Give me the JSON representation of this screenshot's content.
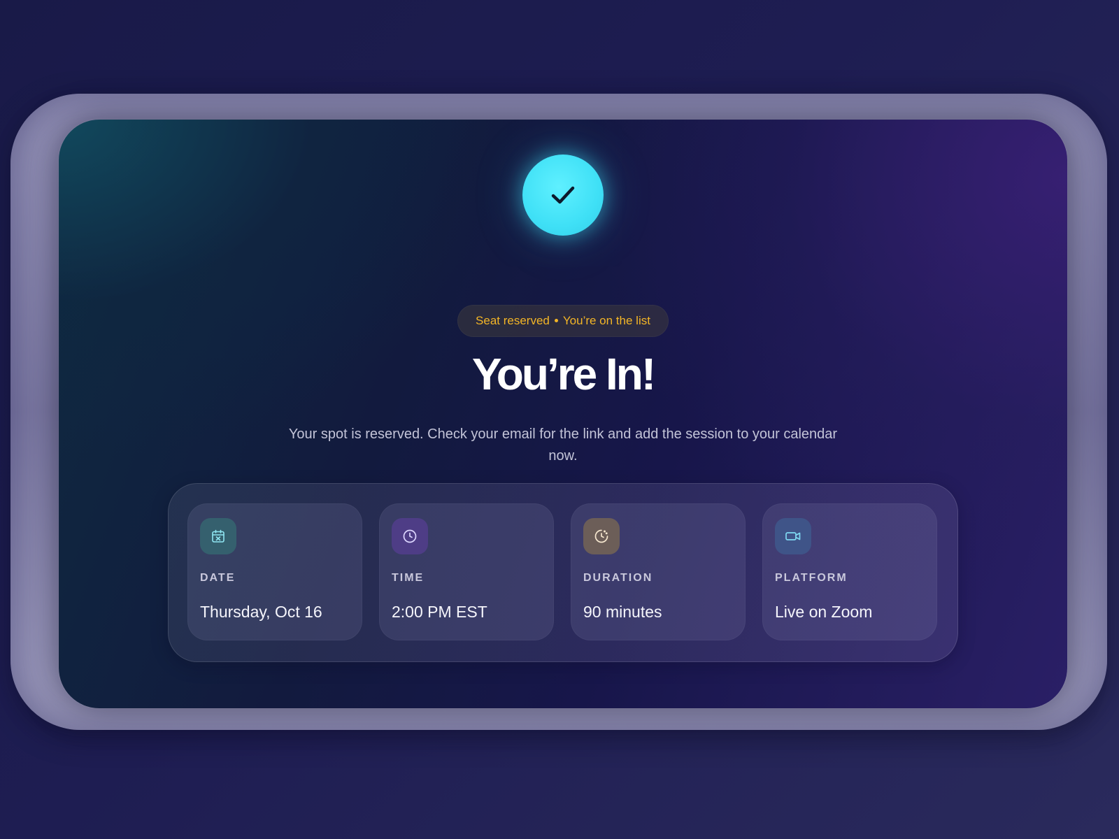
{
  "status": {
    "icon": "check-icon",
    "pill_part1": "Seat reserved",
    "pill_part2": "You’re on the list",
    "pill_color": "#f3b526"
  },
  "heading": "You’re In!",
  "subtext": "Your spot is reserved. Check your email for the link and add the session to your calendar now.",
  "details": [
    {
      "icon": "calendar-icon",
      "label": "DATE",
      "value": "Thursday, Oct 16"
    },
    {
      "icon": "clock-icon",
      "label": "TIME",
      "value": "2:00 PM EST"
    },
    {
      "icon": "timer-icon",
      "label": "DURATION",
      "value": "90 minutes"
    },
    {
      "icon": "video-camera-icon",
      "label": "PLATFORM",
      "value": "Live on Zoom"
    }
  ],
  "colors": {
    "accent_cyan": "#3fe0f6",
    "accent_amber": "#f3b526",
    "text_primary": "#ffffff",
    "text_secondary": "#c3c4d8"
  }
}
